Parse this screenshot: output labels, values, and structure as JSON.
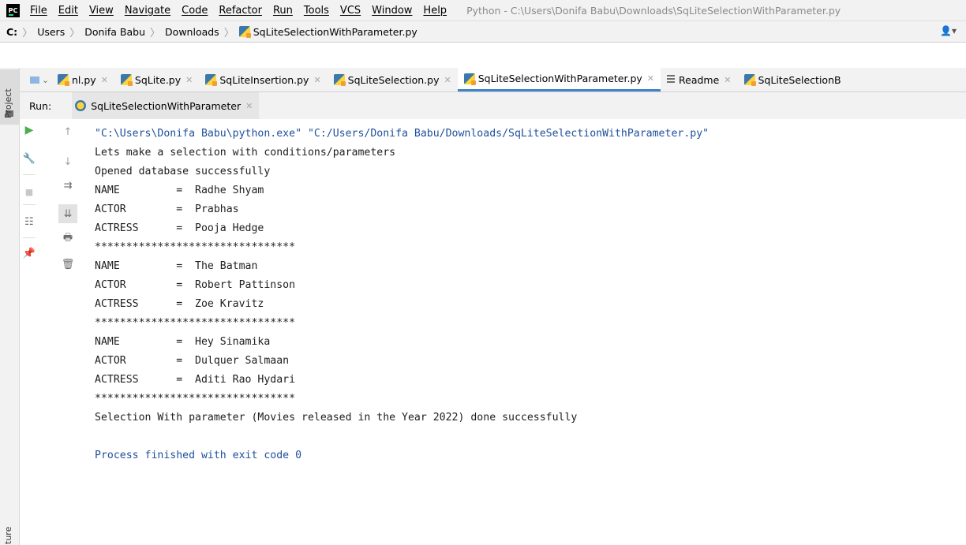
{
  "app": {
    "logo_text": "PC",
    "window_title": "Python - C:\\Users\\Donifa Babu\\Downloads\\SqLiteSelectionWithParameter.py"
  },
  "menu": [
    "File",
    "Edit",
    "View",
    "Navigate",
    "Code",
    "Refactor",
    "Run",
    "Tools",
    "VCS",
    "Window",
    "Help"
  ],
  "breadcrumb": {
    "drive": "C:",
    "items": [
      "Users",
      "Donifa Babu",
      "Downloads",
      "SqLiteSelectionWithParameter.py"
    ]
  },
  "side_panels": {
    "project": "Project",
    "structure": "ture"
  },
  "tabs": [
    {
      "label": "nl.py",
      "icon": "python-file-icon",
      "active": false
    },
    {
      "label": "SqLite.py",
      "icon": "python-file-icon",
      "active": false
    },
    {
      "label": "SqLiteInsertion.py",
      "icon": "python-file-icon",
      "active": false
    },
    {
      "label": "SqLiteSelection.py",
      "icon": "python-file-icon",
      "active": false
    },
    {
      "label": "SqLiteSelectionWithParameter.py",
      "icon": "python-file-icon",
      "active": true
    },
    {
      "label": "Readme",
      "icon": "readme-file-icon",
      "active": false
    },
    {
      "label": "SqLiteSelectionB",
      "icon": "python-file-icon",
      "active": false
    }
  ],
  "run_panel": {
    "label": "Run:",
    "config_tab": "SqLiteSelectionWithParameter"
  },
  "console": {
    "lines": [
      {
        "type": "cmd",
        "text": "\"C:\\Users\\Donifa Babu\\python.exe\" \"C:/Users/Donifa Babu/Downloads/SqLiteSelectionWithParameter.py\""
      },
      {
        "type": "out",
        "text": "Lets make a selection with conditions/parameters"
      },
      {
        "type": "out",
        "text": "Opened database successfully"
      },
      {
        "type": "out",
        "text": "NAME         =  Radhe Shyam"
      },
      {
        "type": "out",
        "text": "ACTOR        =  Prabhas"
      },
      {
        "type": "out",
        "text": "ACTRESS      =  Pooja Hedge"
      },
      {
        "type": "out",
        "text": "********************************"
      },
      {
        "type": "out",
        "text": "NAME         =  The Batman"
      },
      {
        "type": "out",
        "text": "ACTOR        =  Robert Pattinson"
      },
      {
        "type": "out",
        "text": "ACTRESS      =  Zoe Kravitz"
      },
      {
        "type": "out",
        "text": "********************************"
      },
      {
        "type": "out",
        "text": "NAME         =  Hey Sinamika"
      },
      {
        "type": "out",
        "text": "ACTOR        =  Dulquer Salmaan"
      },
      {
        "type": "out",
        "text": "ACTRESS      =  Aditi Rao Hydari"
      },
      {
        "type": "out",
        "text": "********************************"
      },
      {
        "type": "out",
        "text": "Selection With parameter (Movies released in the Year 2022) done successfully"
      },
      {
        "type": "out",
        "text": ""
      },
      {
        "type": "process",
        "text": "Process finished with exit code 0"
      }
    ]
  },
  "colors": {
    "accent": "#4083c9",
    "console_cmd": "#1f4f9c",
    "run_green": "#4cae4f"
  }
}
